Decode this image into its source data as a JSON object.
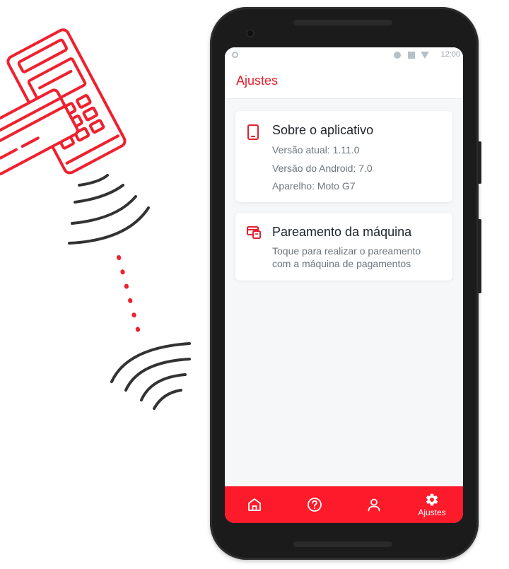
{
  "statusbar": {
    "time": "12:00"
  },
  "appbar": {
    "title": "Ajustes"
  },
  "about_card": {
    "title": "Sobre o aplicativo",
    "app_version": "Versão atual: 1.11.0",
    "android_version": "Versão do Android: 7.0",
    "device": "Aparelho: Moto G7",
    "icon": "smartphone-icon"
  },
  "pairing_card": {
    "title": "Pareamento da máquina",
    "description_line1": "Toque para realizar o pareamento",
    "description_line2": "com a máquina de pagamentos",
    "icon": "card-machine-icon"
  },
  "bottom_nav": {
    "items": [
      {
        "icon": "home-icon"
      },
      {
        "icon": "help-icon"
      },
      {
        "icon": "user-icon"
      },
      {
        "icon": "settings-icon",
        "label": "Ajustes",
        "active": true
      }
    ]
  },
  "colors": {
    "brand_red": "#fd1a2a",
    "title_red": "#e4202f"
  }
}
